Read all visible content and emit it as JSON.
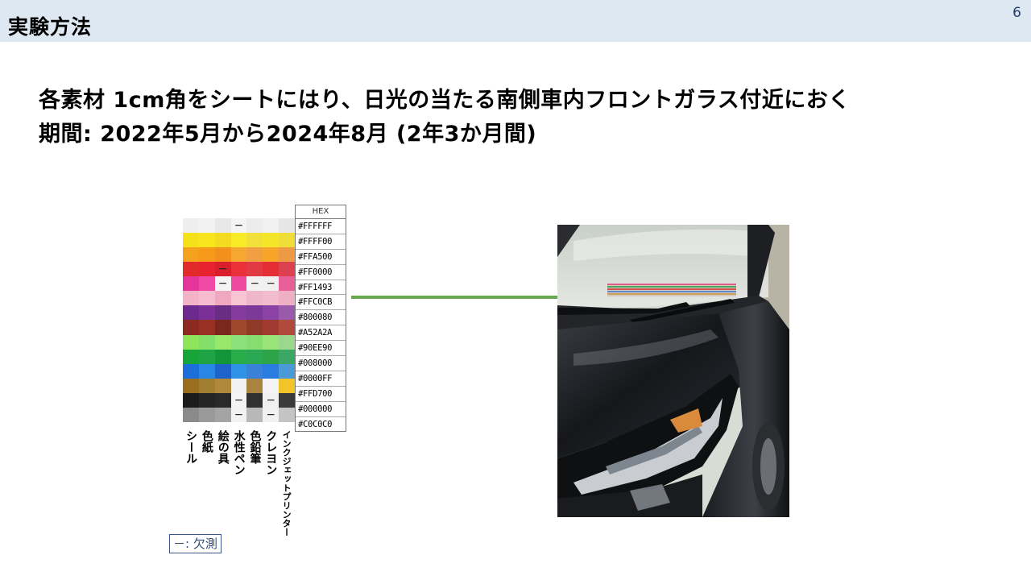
{
  "header": {
    "title": "実験方法",
    "page_number": "6"
  },
  "description": {
    "line1": "各素材 1cm角をシートにはり、日光の当たる南側車内フロントガラス付近におく",
    "line2": "期間: 2022年5月から2024年8月 (2年3か月間)"
  },
  "hex_table": {
    "header": "HEX",
    "rows": [
      "#FFFFFF",
      "#FFFF00",
      "#FFA500",
      "#FF0000",
      "#FF1493",
      "#FFC0CB",
      "#800080",
      "#A52A2A",
      "#90EE90",
      "#008000",
      "#0000FF",
      "#FFD700",
      "#000000",
      "#C0C0C0"
    ]
  },
  "materials": [
    "シール",
    "色紙",
    "絵の具",
    "水性ペン",
    "色鉛筆",
    "クレヨン",
    "インクジェットプリンター"
  ],
  "missing_mark": "－",
  "missing_cells": [
    [
      0,
      3
    ],
    [
      3,
      2
    ],
    [
      4,
      2
    ],
    [
      4,
      4
    ],
    [
      4,
      5
    ],
    [
      12,
      3
    ],
    [
      12,
      5
    ],
    [
      13,
      3
    ],
    [
      13,
      5
    ]
  ],
  "legend": {
    "text": "－: 欠測"
  },
  "arrow_color": "#6aa84f"
}
